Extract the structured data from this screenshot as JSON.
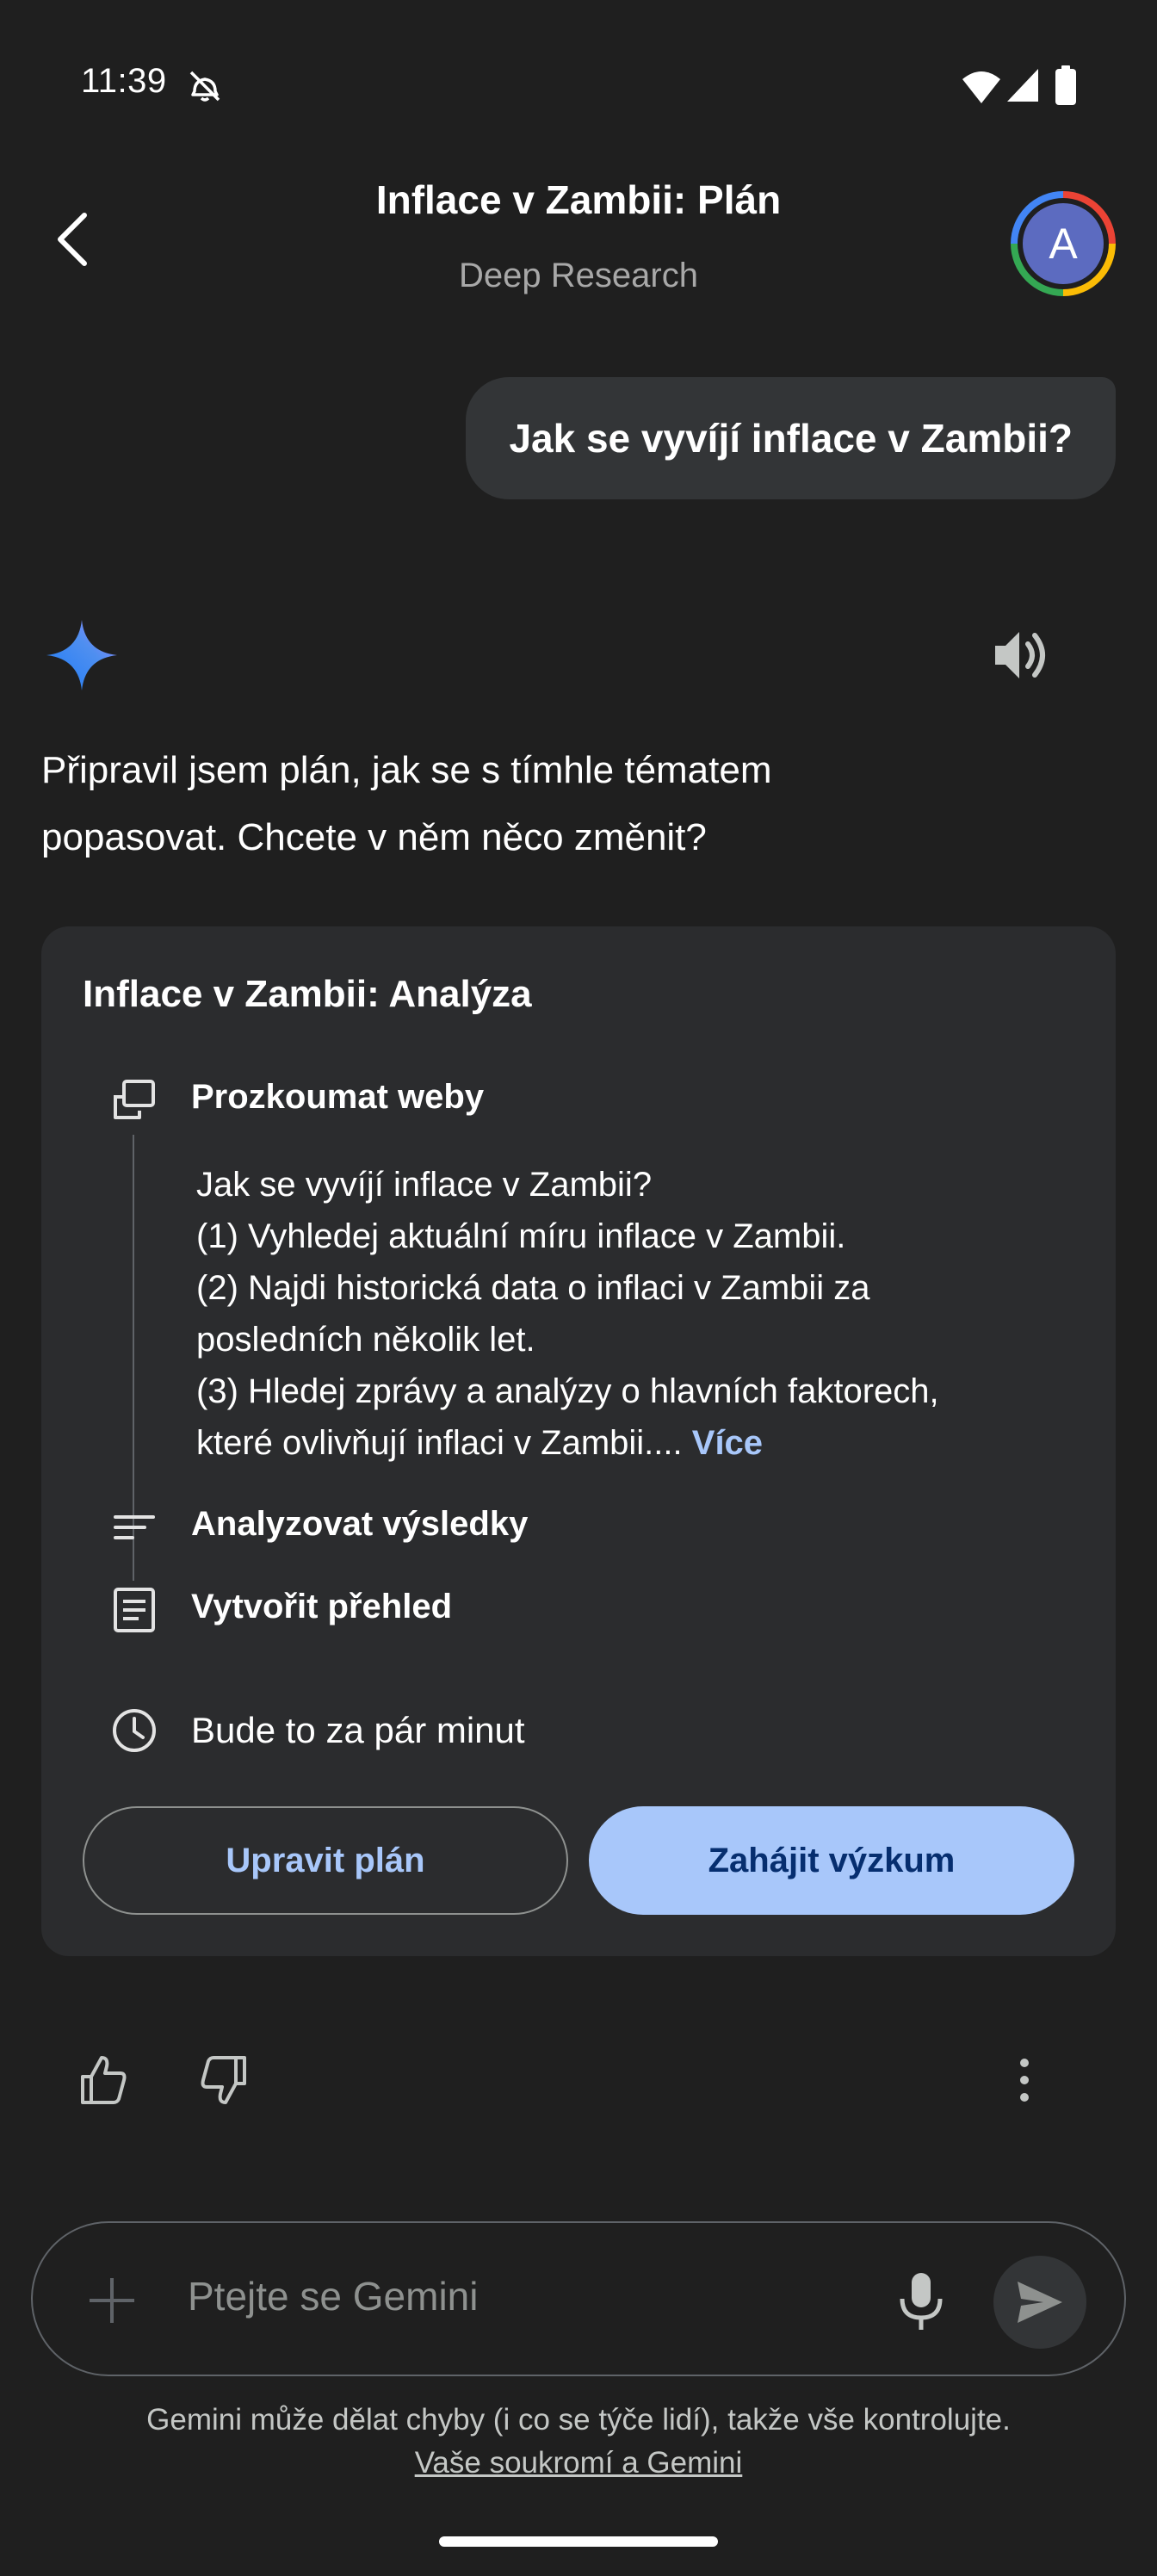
{
  "status_bar": {
    "time": "11:39",
    "icons": [
      "do-not-disturb-off-icon",
      "wifi-icon",
      "signal-icon",
      "battery-icon"
    ]
  },
  "header": {
    "title": "Inflace v Zambii: Plán",
    "subtitle": "Deep Research",
    "avatar_letter": "A",
    "avatar_color": "#5c6bc0"
  },
  "user_message": "Jak se vyvíjí inflace v Zambii?",
  "response": {
    "text_line1": "Připravil jsem plán, jak se s tímhle tématem",
    "text_line2": "popasovat. Chcete v něm něco změnit?"
  },
  "plan": {
    "title": "Inflace v Zambii: Analýza",
    "steps": [
      {
        "label": "Prozkoumat weby",
        "icon": "browse-icon",
        "detail_lines": [
          "Jak se vyvíjí inflace v Zambii?",
          "(1) Vyhledej aktuální míru inflace v Zambii.",
          "(2) Najdi historická data o inflaci v Zambii za",
          "posledních několik let.",
          "(3) Hledej zprávy a analýzy o hlavních faktorech,",
          "které ovlivňují inflaci v Zambii...."
        ],
        "more_label": "Více"
      },
      {
        "label": "Analyzovat výsledky",
        "icon": "analyze-icon"
      },
      {
        "label": "Vytvořit přehled",
        "icon": "report-icon"
      }
    ],
    "duration": "Bude to za pár minut",
    "edit_label": "Upravit plán",
    "start_label": "Zahájit výzkum"
  },
  "input": {
    "placeholder": "Ptejte se Gemini"
  },
  "footer": {
    "disclaimer": "Gemini může dělat chyby (i co se týče lidí), takže vše kontrolujte.",
    "privacy_link": "Vaše soukromí a Gemini"
  },
  "colors": {
    "background": "#1f1f1f",
    "card": "#2b2c2e",
    "accent": "#a8c7fa",
    "accent_text": "#062e6f"
  }
}
